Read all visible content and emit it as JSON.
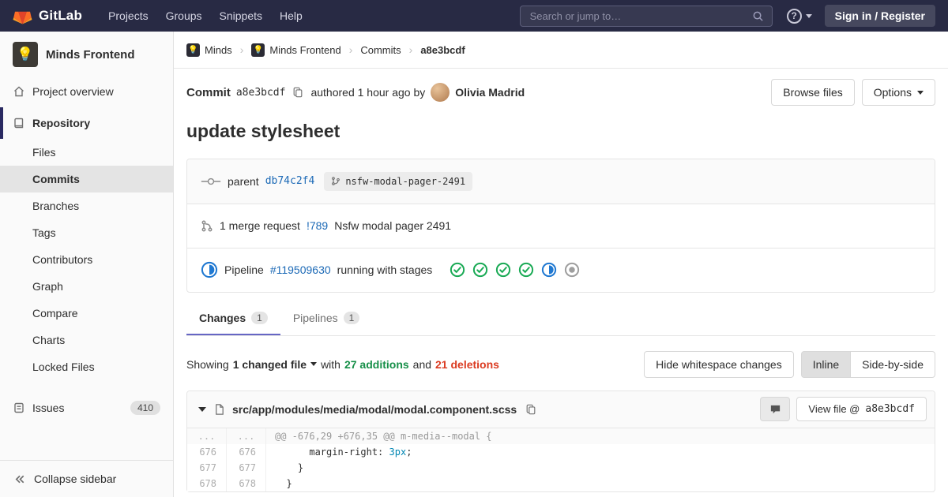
{
  "colors": {
    "navbar_bg": "#282a44",
    "accent_indigo": "#292961",
    "link_blue": "#1b69b6",
    "success_green": "#1aaa55",
    "running_blue": "#1f78d1",
    "additions_green": "#168f48",
    "deletions_red": "#db3b21",
    "tab_indicator": "#6666c4"
  },
  "navbar": {
    "brand": "GitLab",
    "menu": [
      "Projects",
      "Groups",
      "Snippets",
      "Help"
    ],
    "search_placeholder": "Search or jump to…",
    "help_glyph": "?",
    "sign_in_label": "Sign in / Register"
  },
  "sidebar": {
    "project_avatar_emoji": "💡",
    "project_name": "Minds Frontend",
    "overview_label": "Project overview",
    "repository_label": "Repository",
    "repo_items": [
      "Files",
      "Commits",
      "Branches",
      "Tags",
      "Contributors",
      "Graph",
      "Compare",
      "Charts",
      "Locked Files"
    ],
    "active_repo_item": "Commits",
    "issues_label": "Issues",
    "issues_count": "410",
    "collapse_label": "Collapse sidebar"
  },
  "breadcrumb": {
    "group_avatar_emoji": "💡",
    "project_avatar_emoji": "💡",
    "minds": "Minds",
    "minds_frontend": "Minds Frontend",
    "commits": "Commits",
    "sha": "a8e3bcdf"
  },
  "commit": {
    "label": "Commit",
    "sha": "a8e3bcdf",
    "authored_text": "authored 1 hour ago by",
    "author_name": "Olivia Madrid",
    "browse_files_label": "Browse files",
    "options_label": "Options",
    "title": "update stylesheet"
  },
  "details": {
    "parent_label": "parent",
    "parent_sha": "db74c2f4",
    "branch_name": "nsfw-modal-pager-2491",
    "mr_count_text": "1 merge request",
    "mr_ref": "!789",
    "mr_title": "Nsfw modal pager 2491",
    "pipeline_label": "Pipeline",
    "pipeline_ref": "#119509630",
    "pipeline_status_text": "running with stages",
    "stage_statuses": [
      "passed",
      "passed",
      "passed",
      "passed",
      "running",
      "created"
    ]
  },
  "tabs": {
    "changes_label": "Changes",
    "changes_count": "1",
    "pipelines_label": "Pipelines",
    "pipelines_count": "1"
  },
  "toolbar": {
    "showing": "Showing",
    "changed_files": "1 changed file",
    "with": "with",
    "additions": "27 additions",
    "and": "and",
    "deletions": "21 deletions",
    "hide_whitespace_label": "Hide whitespace changes",
    "inline_label": "Inline",
    "side_by_side_label": "Side-by-side"
  },
  "diff": {
    "file_path": "src/app/modules/media/modal/modal.component.scss",
    "view_file_label": "View file @",
    "view_file_sha": "a8e3bcdf",
    "hunk_ellipsis": "...",
    "hunk_header": "@@ -676,29 +676,35 @@ m-media--modal {",
    "lines": [
      {
        "old": "676",
        "new": "676",
        "pre": "      margin-right: ",
        "value": "3px",
        "post": ";"
      },
      {
        "old": "677",
        "new": "677",
        "code": "    }"
      },
      {
        "old": "678",
        "new": "678",
        "code": "  }"
      }
    ]
  }
}
